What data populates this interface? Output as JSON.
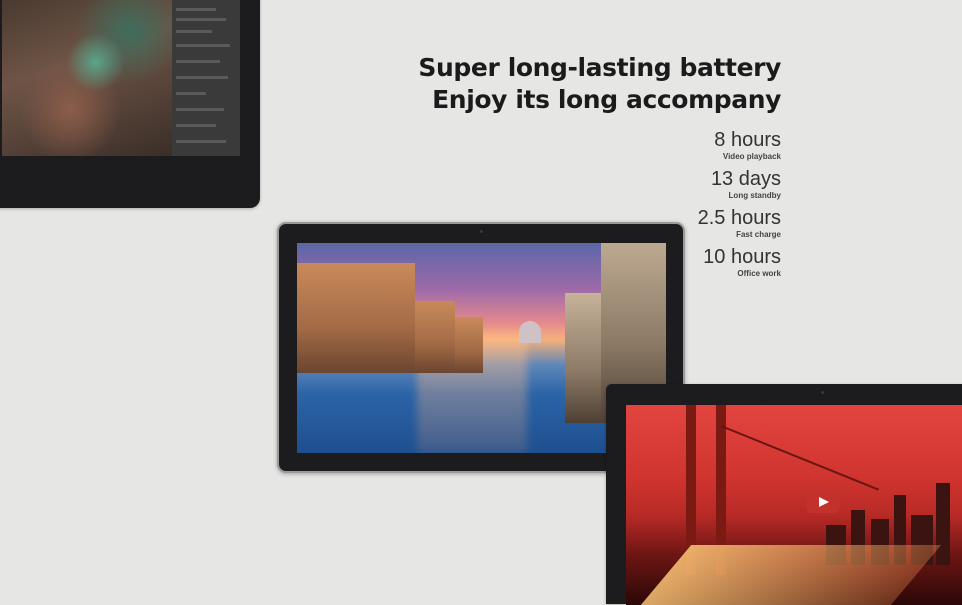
{
  "headline": {
    "line1": "Super long-lasting battery",
    "line2": "Enjoy its long accompany"
  },
  "stats": [
    {
      "value": "8 hours",
      "label": "Video playback"
    },
    {
      "value": "13 days",
      "label": "Long standby"
    },
    {
      "value": "2.5 hours",
      "label": "Fast charge"
    },
    {
      "value": "10 hours",
      "label": "Office work"
    }
  ],
  "colors": {
    "background": "#e6e6e4",
    "device_frame": "#1c1c1e",
    "headline_text": "#1b1b1b",
    "play_button": "#c4302b"
  },
  "icons": {
    "video_play": "play-icon"
  }
}
